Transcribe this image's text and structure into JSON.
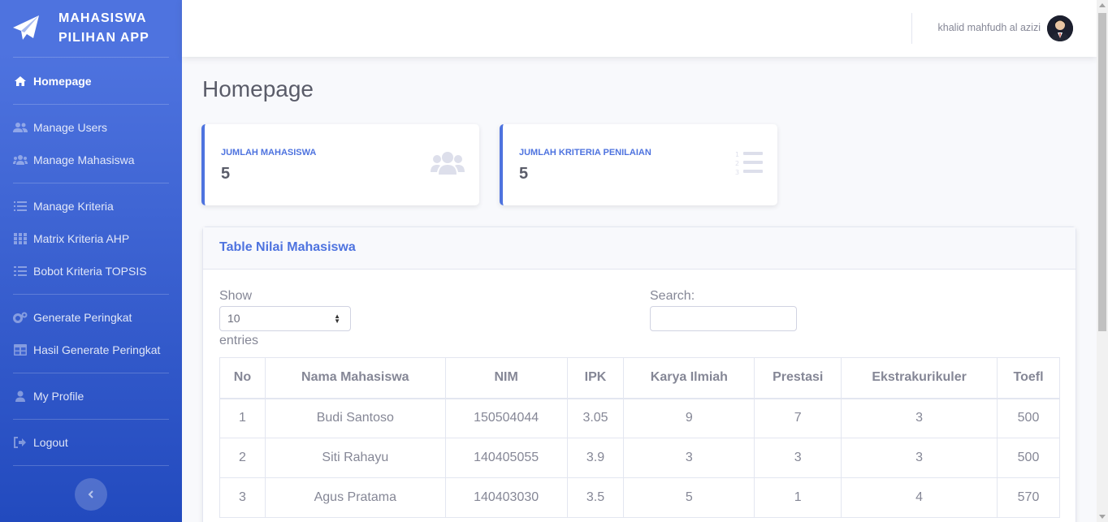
{
  "app": {
    "brand_line1": "MAHASISWA",
    "brand_line2": "PILIHAN APP"
  },
  "sidebar": {
    "items": [
      {
        "label": "Homepage",
        "icon": "home-icon",
        "active": true
      },
      {
        "label": "Manage Users",
        "icon": "user-friends-icon"
      },
      {
        "label": "Manage Mahasiswa",
        "icon": "users-icon"
      },
      {
        "label": "Manage Kriteria",
        "icon": "list-ol-icon"
      },
      {
        "label": "Matrix Kriteria AHP",
        "icon": "th-icon"
      },
      {
        "label": "Bobot Kriteria TOPSIS",
        "icon": "list-icon"
      },
      {
        "label": "Generate Peringkat",
        "icon": "cogs-icon"
      },
      {
        "label": "Hasil Generate Peringkat",
        "icon": "table-icon"
      },
      {
        "label": "My Profile",
        "icon": "user-icon"
      },
      {
        "label": "Logout",
        "icon": "sign-out-icon"
      }
    ]
  },
  "topbar": {
    "user_name": "khalid mahfudh al azizi"
  },
  "main": {
    "page_title": "Homepage",
    "stats": [
      {
        "label": "JUMLAH MAHASISWA",
        "value": "5",
        "icon": "users-icon"
      },
      {
        "label": "JUMLAH KRITERIA PENILAIAN",
        "value": "5",
        "icon": "list-ol-icon"
      }
    ],
    "table_card": {
      "title": "Table Nilai Mahasiswa",
      "show_label": "Show",
      "entries_label": "entries",
      "page_length": "10",
      "search_label": "Search:",
      "search_value": "",
      "columns": [
        "No",
        "Nama Mahasiswa",
        "NIM",
        "IPK",
        "Karya Ilmiah",
        "Prestasi",
        "Ekstrakurikuler",
        "Toefl"
      ],
      "rows": [
        [
          "1",
          "Budi Santoso",
          "150504044",
          "3.05",
          "9",
          "7",
          "3",
          "500"
        ],
        [
          "2",
          "Siti Rahayu",
          "140405055",
          "3.9",
          "3",
          "3",
          "3",
          "500"
        ],
        [
          "3",
          "Agus Pratama",
          "140403030",
          "3.5",
          "5",
          "1",
          "4",
          "570"
        ]
      ]
    }
  },
  "colors": {
    "primary": "#4e73df",
    "sidebar_dark": "#224abe",
    "text": "#858796",
    "heading": "#5a5c69"
  }
}
